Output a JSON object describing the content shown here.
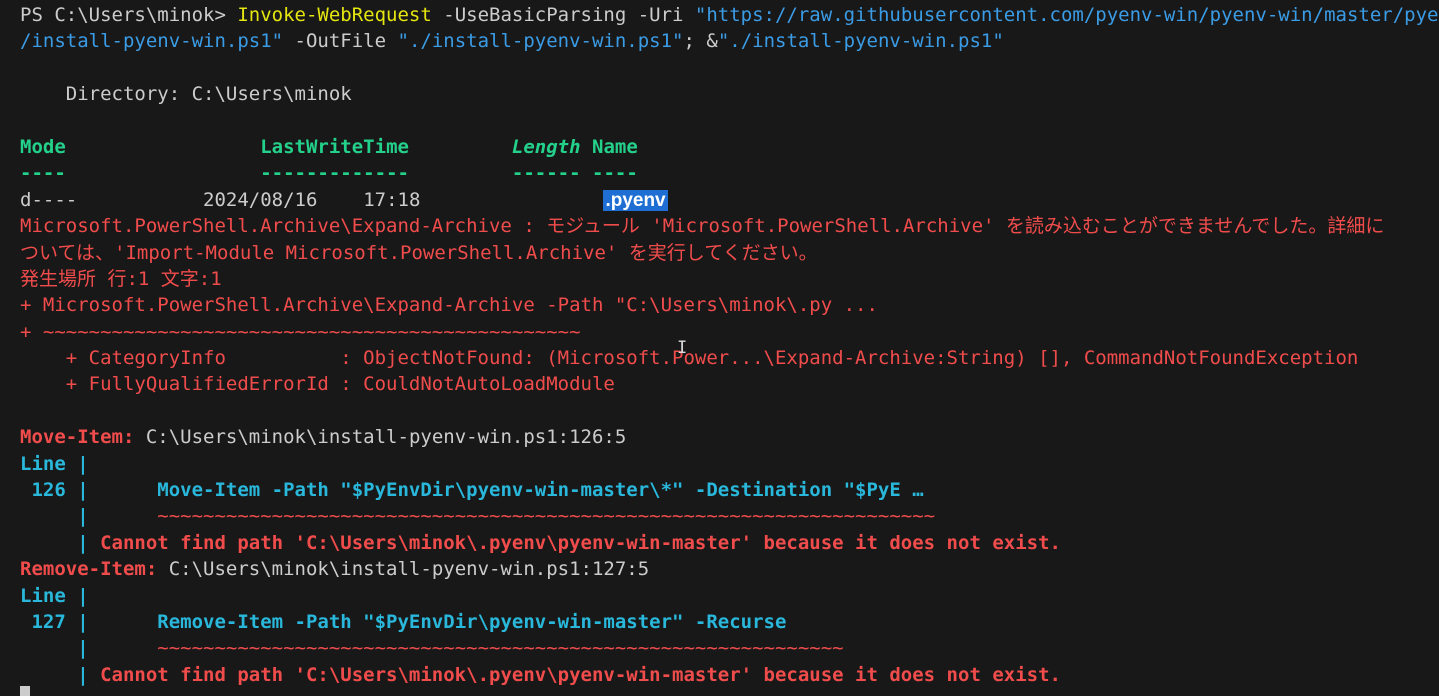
{
  "prompt": {
    "prefix": "PS C:\\Users\\minok> ",
    "command": "Invoke-WebRequest",
    "param_basic": " -UseBasicParsing -Uri ",
    "uri_part1": "\"https://raw.githubusercontent.com/pyenv-win/pyenv-win/master/pyenv-win",
    "uri_part2": "/install-pyenv-win.ps1\"",
    "param_outfile": " -OutFile ",
    "outfile_value": "\"./install-pyenv-win.ps1\"",
    "separator": "; &",
    "run_value": "\"./install-pyenv-win.ps1\""
  },
  "directory": {
    "label": "    Directory: C:\\Users\\minok"
  },
  "listing": {
    "headers": {
      "mode": "Mode",
      "lastwrite": "LastWriteTime",
      "length": "Length",
      "name": "Name"
    },
    "underline_mode": "----",
    "underline_lastwrite": "-------------",
    "underline_length": "------",
    "underline_name": "----",
    "row": {
      "mode": "d----",
      "date": "2024/08/16",
      "time": "17:18",
      "name": ".pyenv"
    }
  },
  "error1": {
    "line1": "Microsoft.PowerShell.Archive\\Expand-Archive : モジュール 'Microsoft.PowerShell.Archive' を読み込むことができませんでした。詳細に",
    "line2": "ついては、'Import-Module Microsoft.PowerShell.Archive' を実行してください。",
    "line3": "発生場所 行:1 文字:1",
    "line4": "+ Microsoft.PowerShell.Archive\\Expand-Archive -Path \"C:\\Users\\minok\\.py ...",
    "line5": "+ ~~~~~~~~~~~~~~~~~~~~~~~~~~~~~~~~~~~~~~~~~~~~~~~",
    "line6": "    + CategoryInfo          : ObjectNotFound: (Microsoft.Power...\\Expand-Archive:String) [], CommandNotFoundException",
    "line7": "    + FullyQualifiedErrorId : CouldNotAutoLoadModule"
  },
  "error2": {
    "label": "Move-Item: ",
    "location": "C:\\Users\\minok\\install-pyenv-win.ps1:126:5",
    "line_label": "Line |",
    "line_num": " 126 |",
    "code": "      Move-Item -Path \"$PyEnvDir\\pyenv-win-master\\*\" -Destination \"$PyE …",
    "pipe_blank": "     |",
    "squiggle": "      ~~~~~~~~~~~~~~~~~~~~~~~~~~~~~~~~~~~~~~~~~~~~~~~~~~~~~~~~~~~~~~~~~~~~",
    "pipe_msg": "     | ",
    "message": "Cannot find path 'C:\\Users\\minok\\.pyenv\\pyenv-win-master' because it does not exist."
  },
  "error3": {
    "label": "Remove-Item: ",
    "location": "C:\\Users\\minok\\install-pyenv-win.ps1:127:5",
    "line_label": "Line |",
    "line_num": " 127 |",
    "code": "      Remove-Item -Path \"$PyEnvDir\\pyenv-win-master\" -Recurse",
    "pipe_blank": "     |",
    "squiggle": "      ~~~~~~~~~~~~~~~~~~~~~~~~~~~~~~~~~~~~~~~~~~~~~~~~~~~~~~~~~~~~",
    "pipe_msg": "     | ",
    "message": "Cannot find path 'C:\\Users\\minok\\.pyenv\\pyenv-win-master' because it does not exist."
  },
  "colors": {
    "background": "#181818",
    "foreground": "#cccccc",
    "error": "#f14c4c",
    "header": "#23d18b",
    "command": "#e5e510",
    "string": "#3b9ce6",
    "cyan": "#29b8db",
    "selection": "#1f6ed4"
  }
}
